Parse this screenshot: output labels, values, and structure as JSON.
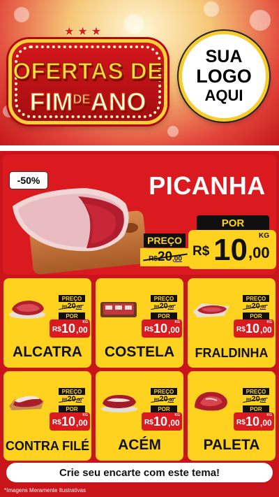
{
  "header": {
    "sign_line1": "OFERTAS DE",
    "sign_fim": "FIM",
    "sign_de": "DE",
    "sign_ano": "ANO",
    "logo": {
      "line1": "SUA",
      "line2": "LOGO",
      "line3": "AQUI"
    }
  },
  "main": {
    "discount": "-50%",
    "title": "PICANHA",
    "preco_label": "PREÇO",
    "old_currency": "R$",
    "old_int": "20",
    "old_dec": ",00",
    "por_label": "POR",
    "currency": "R$",
    "price_int": "10",
    "price_dec": ",00",
    "unit": "KG"
  },
  "cards": [
    {
      "name": "ALCATRA",
      "preco_label": "PREÇO",
      "old_currency": "R$",
      "old_int": "20",
      "old_dec": ",00",
      "por_label": "POR",
      "currency": "R$",
      "price_int": "10",
      "price_dec": ",00",
      "unit": "KG"
    },
    {
      "name": "COSTELA",
      "preco_label": "PREÇO",
      "old_currency": "R$",
      "old_int": "20",
      "old_dec": ",00",
      "por_label": "POR",
      "currency": "R$",
      "price_int": "10",
      "price_dec": ",00",
      "unit": "KG"
    },
    {
      "name": "FRALDINHA",
      "preco_label": "PREÇO",
      "old_currency": "R$",
      "old_int": "20",
      "old_dec": ",00",
      "por_label": "POR",
      "currency": "R$",
      "price_int": "10",
      "price_dec": ",00",
      "unit": "KG"
    },
    {
      "name": "CONTRA FILÉ",
      "preco_label": "PREÇO",
      "old_currency": "R$",
      "old_int": "20",
      "old_dec": ",00",
      "por_label": "POR",
      "currency": "R$",
      "price_int": "10",
      "price_dec": ",00",
      "unit": "KG"
    },
    {
      "name": "ACÉM",
      "preco_label": "PREÇO",
      "old_currency": "R$",
      "old_int": "20",
      "old_dec": ",00",
      "por_label": "POR",
      "currency": "R$",
      "price_int": "10",
      "price_dec": ",00",
      "unit": "KG"
    },
    {
      "name": "PALETA",
      "preco_label": "PREÇO",
      "old_currency": "R$",
      "old_int": "20",
      "old_dec": ",00",
      "por_label": "POR",
      "currency": "R$",
      "price_int": "10",
      "price_dec": ",00",
      "unit": "KG"
    }
  ],
  "footer": {
    "cta": "Crie seu encarte com este tema!",
    "disclaimer": "*Imagens Meramente Ilustrativas"
  },
  "colors": {
    "red": "#db1a1f",
    "yellow": "#ffd21f",
    "black": "#101010",
    "white": "#ffffff"
  }
}
